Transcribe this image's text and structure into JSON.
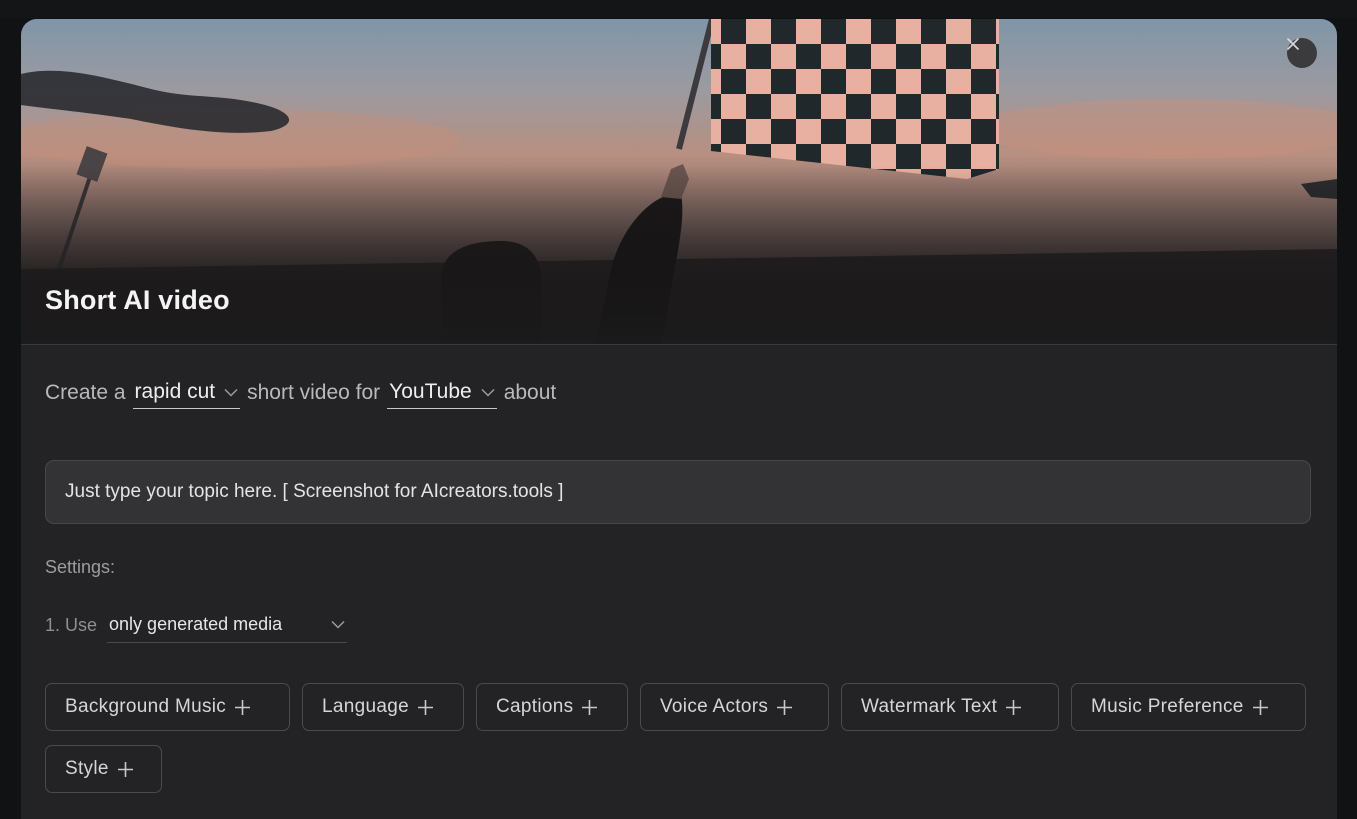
{
  "modal": {
    "title": "Short AI video",
    "close_icon": "close-icon"
  },
  "sentence": {
    "prefix": "Create a",
    "style_value": "rapid cut",
    "middle": "short video for",
    "platform_value": "YouTube",
    "suffix": "about"
  },
  "topic": {
    "value": "Just type your topic here. [ Screenshot for AIcreators.tools ]"
  },
  "settings": {
    "label": "Settings:",
    "use_number": "1. Use",
    "media_value": "only generated media"
  },
  "options": [
    {
      "label": "Background Music"
    },
    {
      "label": "Language"
    },
    {
      "label": "Captions"
    },
    {
      "label": "Voice Actors"
    },
    {
      "label": "Watermark Text"
    },
    {
      "label": "Music Preference"
    },
    {
      "label": "Style"
    }
  ],
  "icons": {
    "dropdown": "chevron-down-icon",
    "add": "plus-icon"
  }
}
